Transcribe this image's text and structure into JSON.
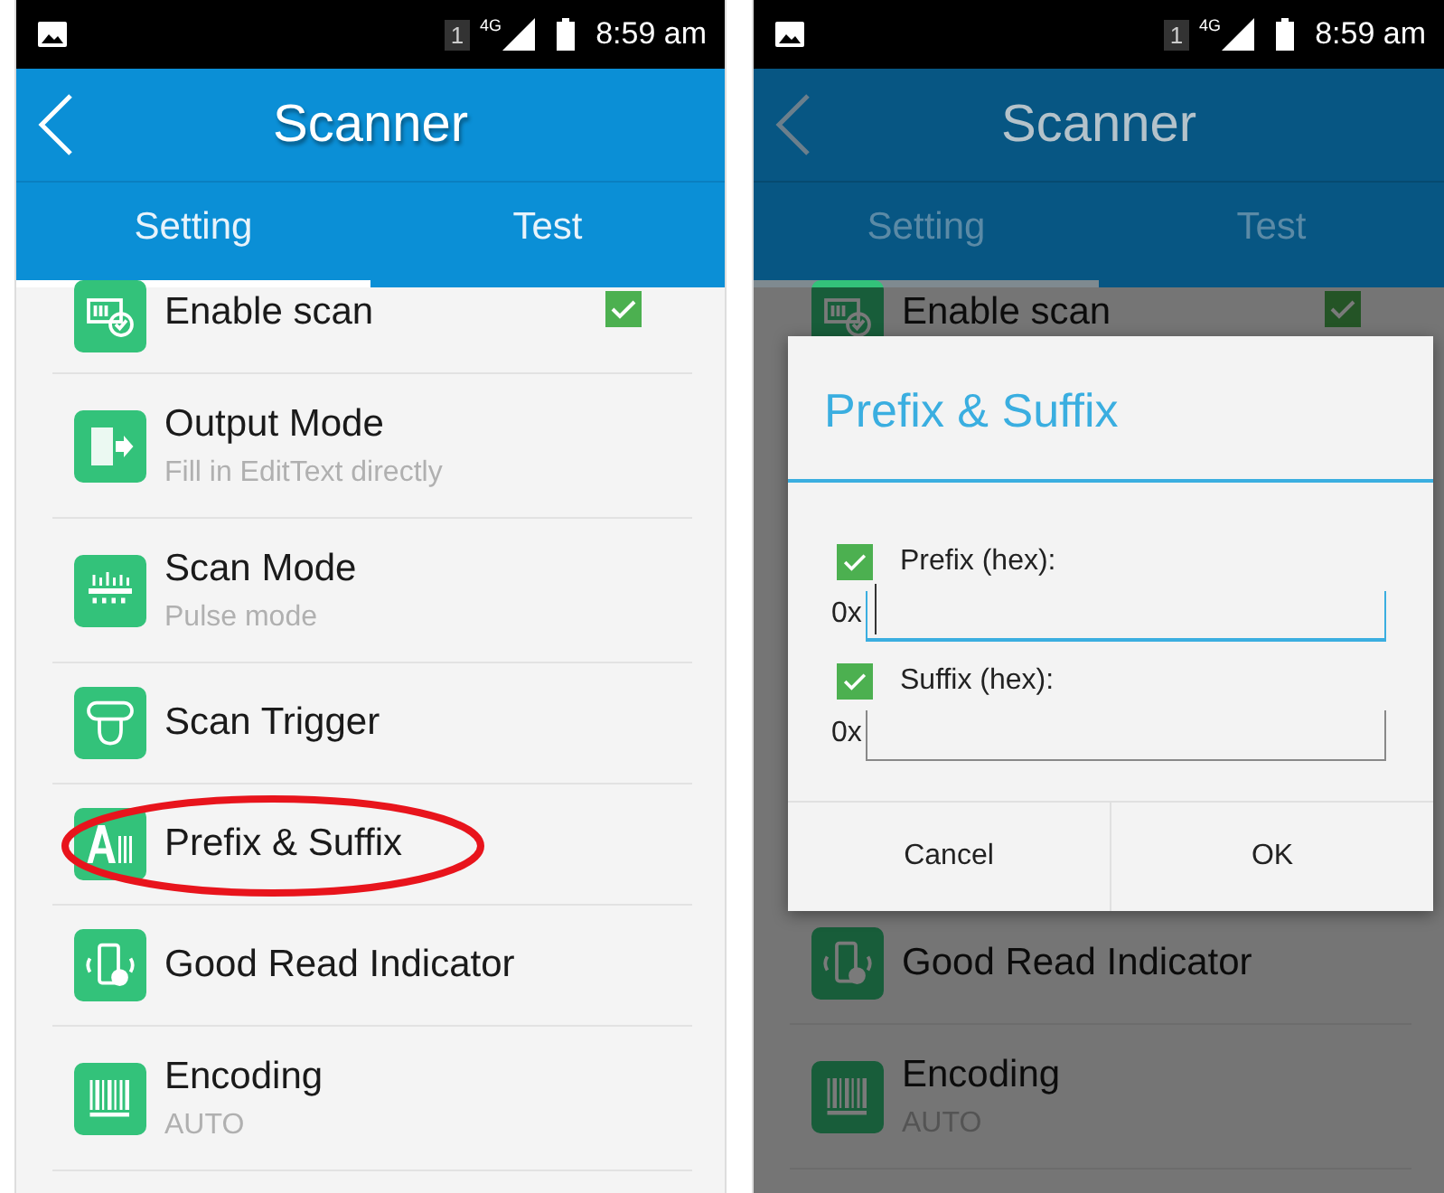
{
  "screens": [
    {
      "dimmed": false,
      "status_bar": {
        "sim": "1",
        "network": "4G",
        "time": "8:59 am"
      },
      "title": "Scanner",
      "tabs": [
        {
          "label": "Setting",
          "selected": true
        },
        {
          "label": "Test",
          "selected": false
        }
      ],
      "items": [
        {
          "kind": "scan",
          "title": "Enable scan",
          "checked": true,
          "highlighted": false
        },
        {
          "kind": "output",
          "title": "Output Mode",
          "subtitle": "Fill in EditText directly",
          "highlighted": false
        },
        {
          "kind": "mode",
          "title": "Scan Mode",
          "subtitle": "Pulse mode",
          "highlighted": false
        },
        {
          "kind": "trigger",
          "title": "Scan Trigger",
          "highlighted": false
        },
        {
          "kind": "prefix",
          "title": "Prefix & Suffix",
          "highlighted": true
        },
        {
          "kind": "indicator",
          "title": "Good Read Indicator",
          "highlighted": false
        },
        {
          "kind": "barcode",
          "title": "Encoding",
          "subtitle": "AUTO",
          "highlighted": false
        }
      ]
    },
    {
      "dimmed": true,
      "status_bar": {
        "sim": "1",
        "network": "4G",
        "time": "8:59 am"
      },
      "title": "Scanner",
      "tabs": [
        {
          "label": "Setting",
          "selected": true
        },
        {
          "label": "Test",
          "selected": false
        }
      ],
      "items": [
        {
          "kind": "scan",
          "title": "Enable scan",
          "checked": true,
          "highlighted": false
        },
        {
          "kind": "indicator",
          "title": "Good Read Indicator",
          "highlighted": false
        },
        {
          "kind": "barcode",
          "title": "Encoding",
          "subtitle": "AUTO",
          "highlighted": false
        }
      ],
      "dialog": {
        "title": "Prefix & Suffix",
        "fields": [
          {
            "label": "Prefix (hex):",
            "checked": true,
            "prefix": "0x",
            "focused": true
          },
          {
            "label": "Suffix (hex):",
            "checked": true,
            "prefix": "0x",
            "focused": false
          }
        ],
        "buttons": [
          "Cancel",
          "OK"
        ]
      }
    }
  ]
}
